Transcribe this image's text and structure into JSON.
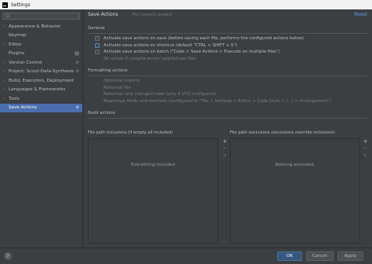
{
  "window": {
    "title": "Settings"
  },
  "sidebar": {
    "search_placeholder": "Q-",
    "items": [
      {
        "label": "Appearance & Behavior",
        "arrow": "›"
      },
      {
        "label": "Keymap",
        "arrow": ""
      },
      {
        "label": "Editor",
        "arrow": "›"
      },
      {
        "label": "Plugins",
        "arrow": "",
        "badge": "1"
      },
      {
        "label": "Version Control",
        "arrow": "›",
        "cfg": "⚙"
      },
      {
        "label": "Project: Scout-Data-Synthesis",
        "arrow": "›",
        "cfg": "⚙"
      },
      {
        "label": "Build, Execution, Deployment",
        "arrow": "›"
      },
      {
        "label": "Languages & Frameworks",
        "arrow": "›"
      },
      {
        "label": "Tools",
        "arrow": "›"
      },
      {
        "label": "Save Actions",
        "arrow": "",
        "cfg": "⚙"
      }
    ]
  },
  "header": {
    "title": "Save Actions",
    "scope": "For current project",
    "reset": "Reset"
  },
  "general": {
    "title": "General",
    "options": [
      "Activate save actions on save (before saving each file, performs the configured actions below)",
      "Activate save actions on shortcut (default \"CTRL + SHIFT + S\")",
      "Activate save actions on batch (\"Code > Save Actions > Execute on multiple files\")",
      "No action if compile errors (applied per file)"
    ]
  },
  "formatting": {
    "title": "Formatting actions",
    "options": [
      "Optimize imports",
      "Reformat file",
      "Reformat only changed code (only if VCS configured)",
      "Rearrange fields and methods (configured in \"File > Settings > Editor > Code Style > (...) > Arrangement\")"
    ]
  },
  "build": {
    "title": "Build actions"
  },
  "inclusions": {
    "label": "File path inclusions (if empty all included)",
    "empty": "Everything included"
  },
  "exclusions": {
    "label": "File path exclusions (exclusions override inclusions)",
    "empty": "Nothing excluded."
  },
  "tools": {
    "add": "+",
    "remove": "−",
    "edit": "✎"
  },
  "footer": {
    "help": "?",
    "ok": "OK",
    "cancel": "Cancel",
    "apply": "Apply"
  }
}
